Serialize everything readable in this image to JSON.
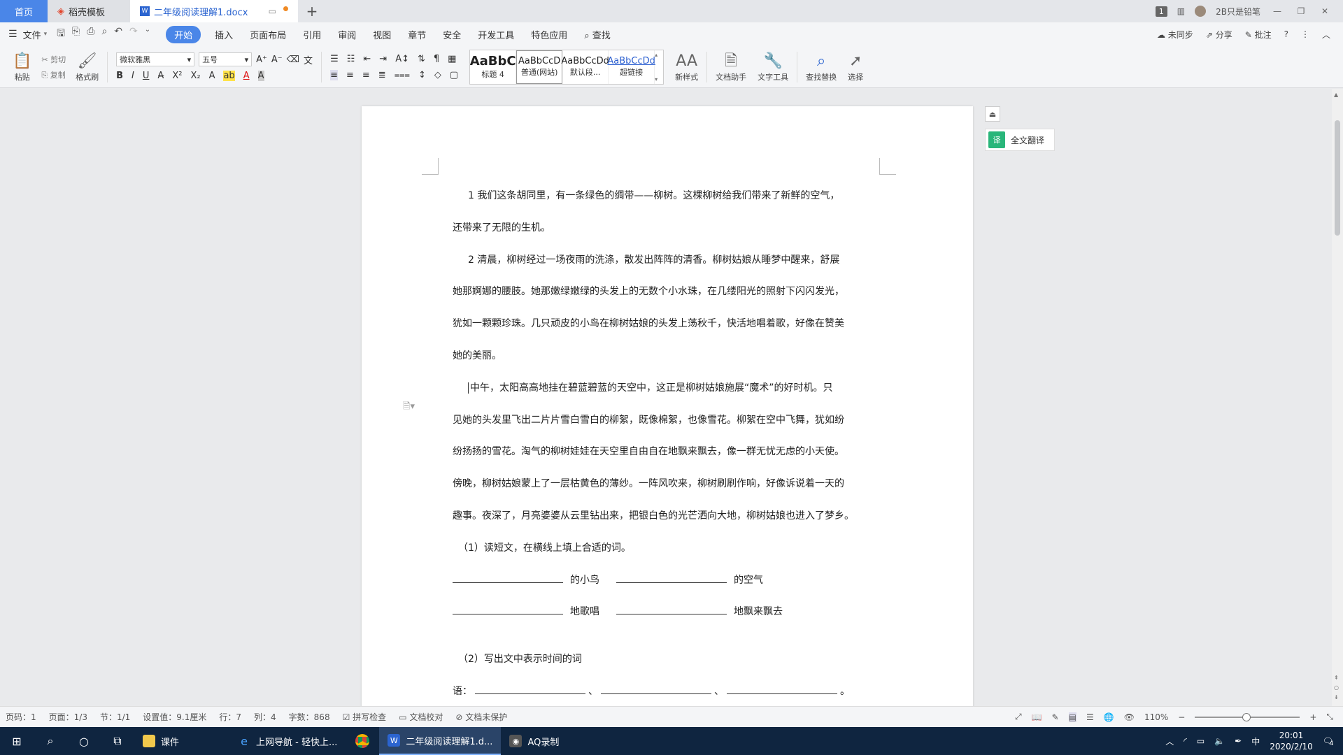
{
  "tabs": {
    "home": "首页",
    "daoke": "稻壳模板",
    "doc": "二年级阅读理解1.docx",
    "add": "+"
  },
  "titlebar_right": {
    "badge": "1",
    "user": "2B只是铅笔"
  },
  "menu": {
    "file": "文件",
    "items": [
      "开始",
      "插入",
      "页面布局",
      "引用",
      "审阅",
      "视图",
      "章节",
      "安全",
      "开发工具",
      "特色应用"
    ],
    "search": "查找",
    "sync": "未同步",
    "share": "分享",
    "comment": "批注"
  },
  "ribbon": {
    "paste": "粘贴",
    "cut": "剪切",
    "copy": "复制",
    "format_painter": "格式刷",
    "font_name": "微软雅黑",
    "font_size": "五号",
    "styles": [
      {
        "sample": "AaBbC",
        "name": "标题 4"
      },
      {
        "sample": "AaBbCcD",
        "name": "普通(网站)"
      },
      {
        "sample": "AaBbCcDd",
        "name": "默认段..."
      },
      {
        "sample": "AaBbCcDd",
        "name": "超链接"
      }
    ],
    "new_style": "新样式",
    "doc_helper": "文档助手",
    "text_tools": "文字工具",
    "find_replace": "查找替换",
    "select": "选择"
  },
  "document": {
    "p1_line1": "1 我们这条胡同里，有一条绿色的绸带——柳树。这棵柳树给我们带来了新鲜的空气，",
    "p1_line2": "还带来了无限的生机。",
    "p2_line1": "2 清晨，柳树经过一场夜雨的洗涤，散发出阵阵的清香。柳树姑娘从睡梦中醒来，舒展",
    "p2_line2": "她那婀娜的腰肢。她那嫩绿嫩绿的头发上的无数个小水珠，在几缕阳光的照射下闪闪发光，",
    "p2_line3": "犹如一颗颗珍珠。几只顽皮的小鸟在柳树姑娘的头发上荡秋千，快活地唱着歌，好像在赞美",
    "p2_line4": "她的美丽。",
    "p3_line1": "中午，太阳高高地挂在碧蓝碧蓝的天空中，这正是柳树姑娘施展“魔术”的好时机。只",
    "p3_line2": "见她的头发里飞出二片片雪白雪白的柳絮，既像棉絮，也像雪花。柳絮在空中飞舞，犹如纷",
    "p3_line3": "纷扬扬的雪花。淘气的柳树娃娃在天空里自由自在地飘来飘去，像一群无忧无虑的小天使。",
    "p3_line4": "傍晚，柳树姑娘蒙上了一层枯黄色的薄纱。一阵风吹来，柳树刷刷作响，好像诉说着一天的",
    "p3_line5": "趣事。夜深了，月亮婆婆从云里钻出来，把银白色的光芒洒向大地，柳树姑娘也进入了梦乡。",
    "q1": "（1）读短文，在横线上填上合适的词。",
    "q1_a": "的小鸟",
    "q1_b": "的空气",
    "q1_c": "地歌唱",
    "q1_d": "地飘来飘去",
    "q2": "（2）写出文中表示时间的词",
    "q2_prefix": "语：",
    "q2_sep1": "、",
    "q2_sep2": "、",
    "q2_end": "。"
  },
  "side": {
    "translate": "全文翻译",
    "translate_icon_text": "译"
  },
  "status": {
    "page_code": "页码：1",
    "page": "页面：1/3",
    "section": "节：1/1",
    "setting": "设置值：9.1厘米",
    "row": "行：7",
    "col": "列：4",
    "words": "字数：868",
    "spell": "拼写检查",
    "proof": "文档校对",
    "protect": "文档未保护",
    "zoom": "110%"
  },
  "taskbar": {
    "folder": "课件",
    "browser": "上网导航 - 轻快上...",
    "wps": "二年级阅读理解1.d...",
    "aq": "AQ录制",
    "ime": "中",
    "time": "20:01",
    "date": "2020/2/10",
    "notif": "4"
  },
  "colors": {
    "accent": "#4a86e8",
    "translate_green": "#29b67a",
    "taskbar": "#0f2540"
  }
}
